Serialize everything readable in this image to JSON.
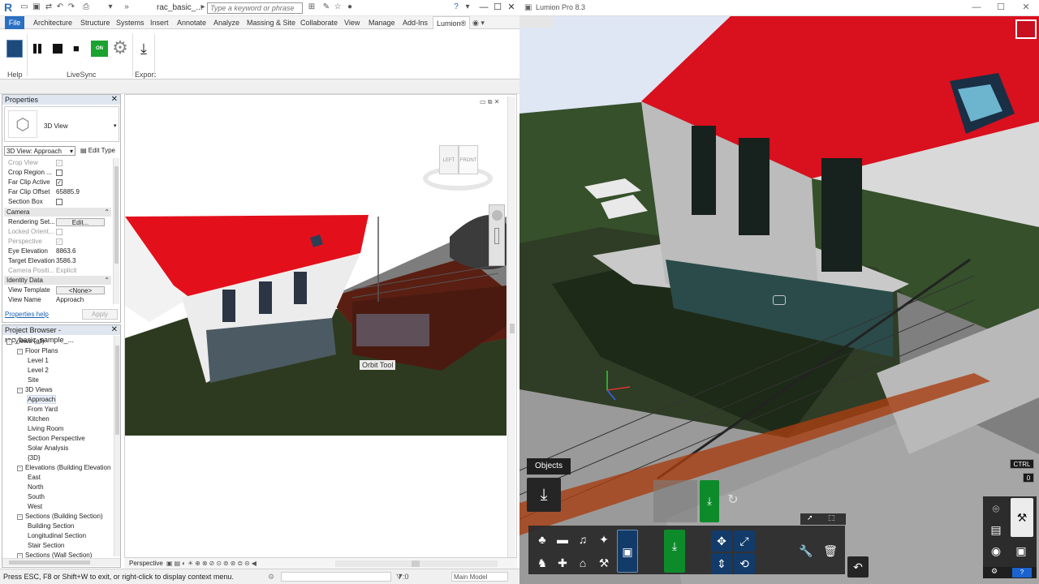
{
  "revit": {
    "document_title": "rac_basic_...",
    "search_placeholder": "Type a keyword or phrase",
    "user": "",
    "tabs": [
      "File",
      "Architecture",
      "Structure",
      "Systems",
      "Insert",
      "Annotate",
      "Analyze",
      "Massing & Site",
      "Collaborate",
      "View",
      "Manage",
      "Add-Ins",
      "Lumion®"
    ],
    "ribbon": {
      "livesync_on_label": "ON",
      "groups": [
        "Help",
        "LiveSync",
        "Export"
      ]
    },
    "properties": {
      "title": "Properties",
      "type_name": "3D View",
      "view_selector": "3D View: Approach",
      "edit_type": "Edit Type",
      "rows": [
        {
          "k": "Crop View",
          "v": "",
          "check": true,
          "dim": true
        },
        {
          "k": "Crop Region ...",
          "v": "",
          "check": false,
          "dim": false
        },
        {
          "k": "Far Clip Active",
          "v": "",
          "check": true,
          "dim": false
        },
        {
          "k": "Far Clip Offset",
          "v": "65885.9",
          "dim": false
        }
      ],
      "section_box": "Section Box",
      "camera_header": "Camera",
      "camera_rows": [
        {
          "k": "Rendering Set...",
          "v": "Edit...",
          "button": true
        },
        {
          "k": "Locked Orient...",
          "v": "",
          "dim": true
        },
        {
          "k": "Perspective",
          "v": "",
          "dim": true
        },
        {
          "k": "Eye Elevation",
          "v": "8863.6"
        },
        {
          "k": "Target Elevation",
          "v": "3586.3"
        },
        {
          "k": "Camera Positi...",
          "v": "Explicit",
          "dim": true
        }
      ],
      "identity_header": "Identity Data",
      "identity_rows": [
        {
          "k": "View Template",
          "v": "<None>",
          "button": true
        },
        {
          "k": "View Name",
          "v": "Approach"
        }
      ],
      "help_link": "Properties help",
      "apply": "Apply"
    },
    "browser": {
      "title": "Project Browser - rac_basic_sample_...",
      "nodes": [
        {
          "label": "Views (all)",
          "depth": 0,
          "toggle": "-"
        },
        {
          "label": "Floor Plans",
          "depth": 1,
          "toggle": "-"
        },
        {
          "label": "Level 1",
          "depth": 2
        },
        {
          "label": "Level 2",
          "depth": 2
        },
        {
          "label": "Site",
          "depth": 2
        },
        {
          "label": "3D Views",
          "depth": 1,
          "toggle": "-"
        },
        {
          "label": "Approach",
          "depth": 2,
          "selected": true
        },
        {
          "label": "From Yard",
          "depth": 2
        },
        {
          "label": "Kitchen",
          "depth": 2
        },
        {
          "label": "Living Room",
          "depth": 2
        },
        {
          "label": "Section Perspective",
          "depth": 2
        },
        {
          "label": "Solar Analysis",
          "depth": 2
        },
        {
          "label": "{3D}",
          "depth": 2
        },
        {
          "label": "Elevations (Building Elevation",
          "depth": 1,
          "toggle": "-"
        },
        {
          "label": "East",
          "depth": 2
        },
        {
          "label": "North",
          "depth": 2
        },
        {
          "label": "South",
          "depth": 2
        },
        {
          "label": "West",
          "depth": 2
        },
        {
          "label": "Sections (Building Section)",
          "depth": 1,
          "toggle": "-"
        },
        {
          "label": "Building Section",
          "depth": 2
        },
        {
          "label": "Longitudinal Section",
          "depth": 2
        },
        {
          "label": "Stair Section",
          "depth": 2
        },
        {
          "label": "Sections (Wall Section)",
          "depth": 1,
          "toggle": "-"
        }
      ]
    },
    "view": {
      "tooltip": "Orbit Tool",
      "viewcube_left": "LEFT",
      "viewcube_front": "FRONT",
      "view_mode": "Perspective"
    },
    "status": {
      "message": "Press ESC, F8 or Shift+W to exit, or right-click to display context menu.",
      "coord": ":0",
      "model": "Main Model"
    }
  },
  "lumion": {
    "title": "Lumion Pro 8.3",
    "objects_tab": "Objects",
    "ctrl_label": "CTRL",
    "zero_label": "0",
    "help": "?",
    "colors": {
      "roof": "#e0101f",
      "grass": "#3d5a26",
      "panel": "#252525",
      "green_btn": "#0d8b2b",
      "blue_btn": "#123b6a"
    }
  }
}
